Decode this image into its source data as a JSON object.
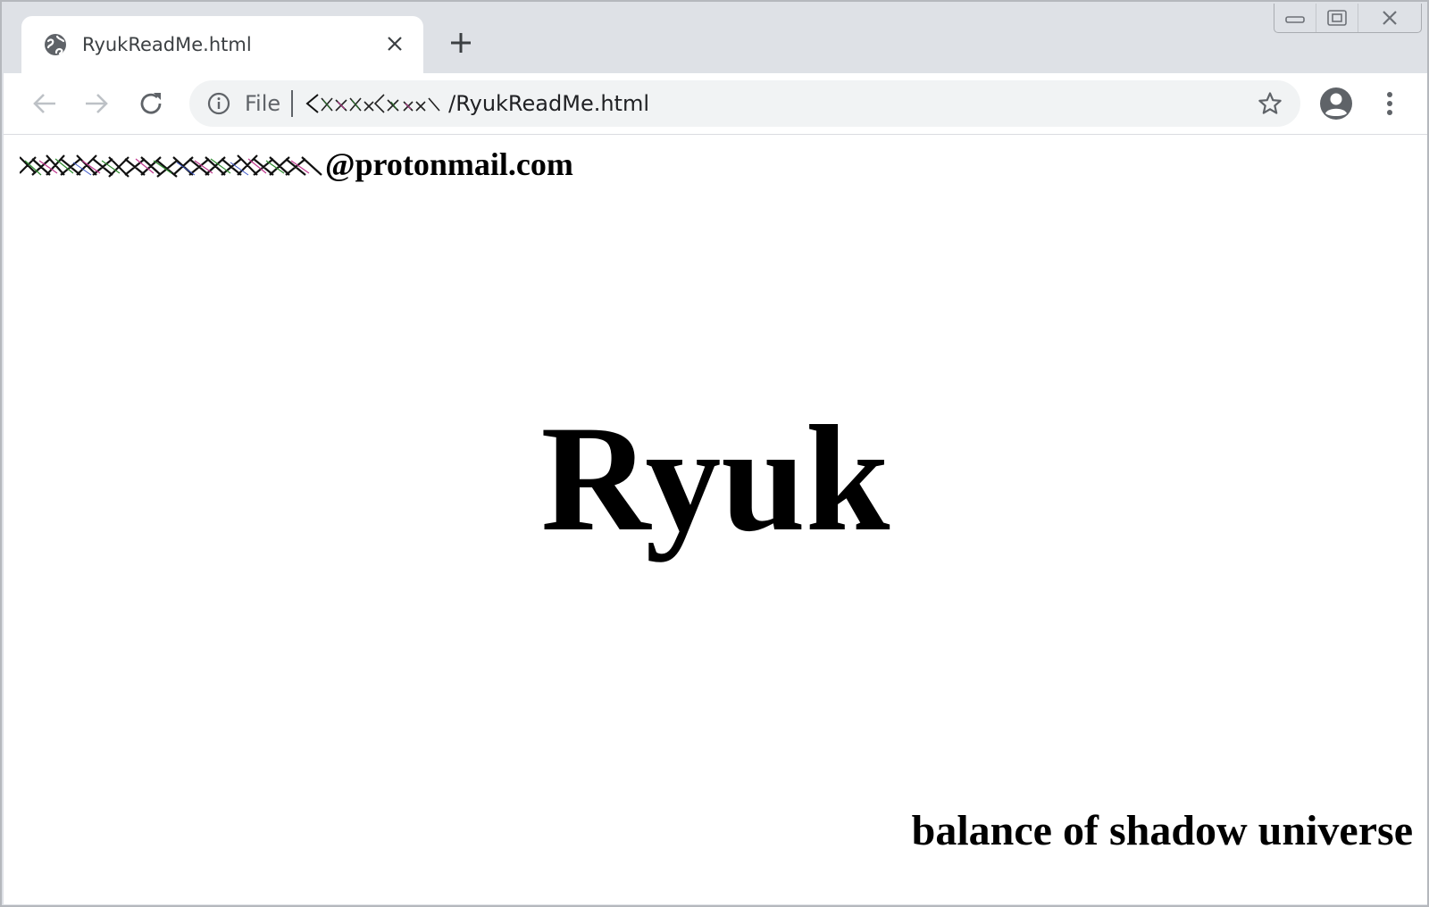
{
  "browser": {
    "tab": {
      "title": "RyukReadMe.html"
    },
    "address_bar": {
      "scheme_label": "File",
      "path_suffix": "/RyukReadMe.html"
    },
    "icons": {
      "favicon": "globe-icon",
      "back": "arrow-left-icon",
      "forward": "arrow-right-icon",
      "reload": "reload-icon",
      "info": "info-icon",
      "bookmark": "star-icon",
      "profile": "account-circle-icon",
      "menu": "kebab-menu-icon",
      "minimize": "minimize-icon",
      "restore": "restore-icon",
      "close": "close-icon"
    }
  },
  "page": {
    "email_domain": "@protonmail.com",
    "headline": "Ryuk",
    "tagline": "balance of shadow universe"
  },
  "colors": {
    "chrome_bg": "#dee1e6",
    "omnibox_bg": "#f1f3f4",
    "icon_gray": "#5f6368",
    "text": "#000000"
  }
}
